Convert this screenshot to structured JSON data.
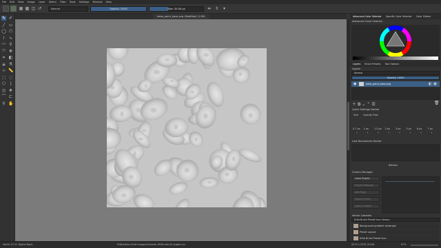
{
  "menu": [
    "File",
    "Edit",
    "View",
    "Image",
    "Layer",
    "Select",
    "Filter",
    "Tools",
    "Settings",
    "Window",
    "Help"
  ],
  "toolbar": {
    "blend_mode": "Normal",
    "opacity_label": "Opacity: 100%",
    "opacity_value": 1.0,
    "size_label": "Size: 35.00 px",
    "size_value": 0.35
  },
  "document": {
    "tab_title": "baba_paint_base.png (Modified) (1.89)"
  },
  "dock": {
    "color_tabs": [
      "Advanced Color Selector",
      "Specific Color Selector",
      "Color Sliders"
    ],
    "color_title": "Advanced Color Selector",
    "layer_tabs": [
      "Layers",
      "Brush Presets",
      "Tool Options"
    ],
    "layers_title": "Layers",
    "layers_blend": "Normal",
    "layers_opacity": "Opacity: 100%",
    "layer_name": "baba_paint_base.png",
    "quick_title": "Quick Settings Docker",
    "quick_tabs": [
      "Size",
      "Opacity",
      "Flow"
    ],
    "quick_sizes": [
      "0.7 px",
      "1 px",
      "1.5 px",
      "2 px",
      "3 px",
      "5 px",
      "6 px",
      "7 px"
    ],
    "last_docs_title": "Last Documents Docker",
    "refresh_label": "Refresh",
    "comics_title": "Comics Manager",
    "comics_buttons": [
      "Open Project",
      "Project Settings",
      "Add Page",
      "Export Comic",
      "Open in editor"
    ],
    "vector_title": "Vector Libraries",
    "vector_library": "Krita Brush Preset Icon Library",
    "presets": [
      "Background gradient rectangle",
      "Preset Layout",
      "Krita Brush Preset Icon"
    ]
  },
  "status": {
    "left": "Ventin 01 01 Digital Basic",
    "middle": "RGB/Alpha (8-bit integer/channel)  sRGB-elle-V2-srgbtrc.icc",
    "right": "2079 x 2079 (9.2M)",
    "zoom": "67%"
  },
  "colors": {
    "accent": "#3b5f86",
    "canvas_bg": "#7b7b7b"
  }
}
